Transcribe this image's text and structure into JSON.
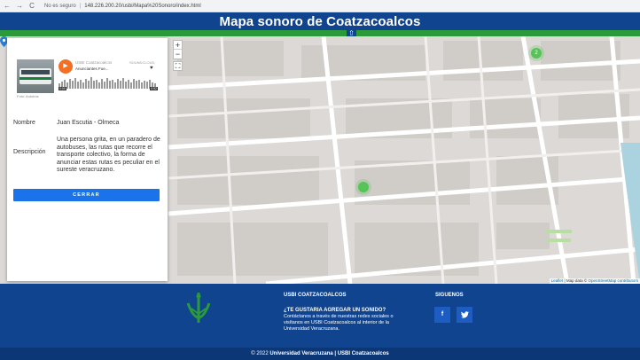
{
  "browser": {
    "back": "←",
    "forward": "→",
    "reload": "C",
    "security_label": "No es seguro",
    "url": "148.226.200.20/usbi/Mapa%20Sonoro/index.html"
  },
  "header": {
    "title": "Mapa sonoro de Coatzacoalcos",
    "up_arrow": "⇧"
  },
  "map": {
    "zoom_in": "+",
    "zoom_out": "−",
    "fullscreen": "⛶",
    "markers": [
      "2",
      "",
      ""
    ],
    "attribution_leaflet": "Leaflet",
    "attribution_text": "| Map data ©",
    "attribution_osm": "OpenStreetMap contributors"
  },
  "panel": {
    "thumb_caption": "Foto: Autobús",
    "player": {
      "user": "USBI Coatzacoalcos",
      "track": "Anunciantes Fue...",
      "brand": "SOUNDCLOUD",
      "heart": "♥",
      "time_left": "0:00",
      "time_right": "0:52"
    },
    "name_label": "Nombre",
    "name_value": "Juan Escutia - Olmeca",
    "description_label": "Descripción",
    "description_value": "Una persona grita, en un paradero de autobuses, las rutas que recorre el transporte colectivo, la forma de anunciar estas rutas es peculiar en el sureste veracruzano.",
    "close_button": "CERRAR"
  },
  "footer": {
    "usbi_heading": "USBI COATZACOALCOS",
    "question_heading": "¿TE GUSTARIA AGREGAR UN SONIDO?",
    "question_text": "Contáctanos a través de nuestras redes sociales o visítanos en USBI Coatzacoalcos al interior de la Universidad Veracruzana.",
    "social_heading": "SIGUENOS",
    "facebook": "f",
    "twitter": "🐦",
    "copyright_prefix": "© 2022",
    "copyright_bold": "Universidad Veracruzana | USBI Coatzacoalcos"
  },
  "colors": {
    "header_blue": "#11448e",
    "green_strip": "#2b9a3a",
    "button_blue": "#1a73e8",
    "marker_green": "#56c456",
    "soundcloud_orange": "#f26f23"
  }
}
